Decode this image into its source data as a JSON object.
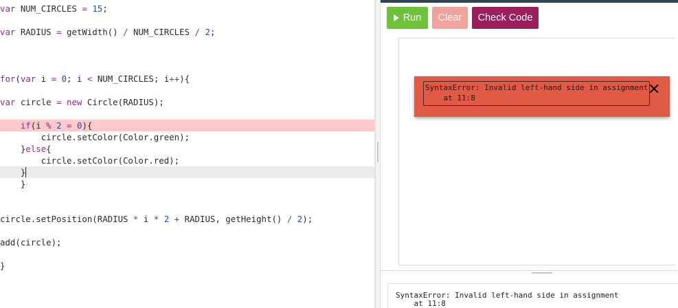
{
  "editor": {
    "lines": {
      "l1": {
        "kw": "var",
        "rest": " NUM_CIRCLES ",
        "op": "=",
        "sp": " ",
        "num": "15",
        "end": ";"
      },
      "l3": {
        "kw": "var",
        "rest": " RADIUS ",
        "op": "=",
        "mid": " getWidth() ",
        "op2": "/",
        "sp": " NUM_CIRCLES ",
        "op3": "/",
        "sp2": " ",
        "num": "2",
        "end": ";"
      },
      "l6": {
        "kw": "for",
        "p1": "(",
        "kw2": "var",
        "a": " i ",
        "op": "=",
        "sp": " ",
        "num": "0",
        "b": "; i ",
        "op2": "<",
        "c": " NUM_CIRCLES; i",
        "op3": "++",
        "d": "){"
      },
      "l8": {
        "kw": "var",
        "a": " circle ",
        "op": "=",
        "sp": " ",
        "kw2": "new",
        "b": " Circle(RADIUS);"
      },
      "l10": {
        "indent": "    ",
        "kw": "if",
        "a": "(i ",
        "op": "%",
        "sp": " ",
        "num": "2",
        "sp2": " ",
        "op2": "=",
        "sp3": " ",
        "num2": "0",
        "b": "){"
      },
      "l11": {
        "text": "        circle.setColor(Color.green);"
      },
      "l12": {
        "indent": "    ",
        "a": "}",
        "kw": "else",
        "b": "{"
      },
      "l13": {
        "text": "        circle.setColor(Color.red);"
      },
      "l14": {
        "text": "    }"
      },
      "l15": {
        "text": "    }"
      },
      "l18": {
        "a": "circle.setPosition(RADIUS ",
        "op": "*",
        "b": " i ",
        "op2": "*",
        "sp": " ",
        "num": "2",
        "sp2": " ",
        "op3": "+",
        "c": " RADIUS, getHeight() ",
        "op4": "/",
        "sp3": " ",
        "num2": "2",
        "d": ");"
      },
      "l20": {
        "text": "add(circle);"
      },
      "l22": {
        "text": "}"
      }
    }
  },
  "toolbar": {
    "run_label": "Run",
    "clear_label": "Clear",
    "check_label": "Check Code"
  },
  "error_popup": {
    "message": "SyntaxError: Invalid left-hand side in assignment\n    at 11:8",
    "close_glyph": "✕"
  },
  "console": {
    "text": "SyntaxError: Invalid left-hand side in assignment\n    at 11:8"
  },
  "colors": {
    "run": "#70c13a",
    "clear": "#f0a39c",
    "check": "#9c1f5c",
    "error_popup": "#e05a45",
    "error_line": "#ffc9c9"
  }
}
